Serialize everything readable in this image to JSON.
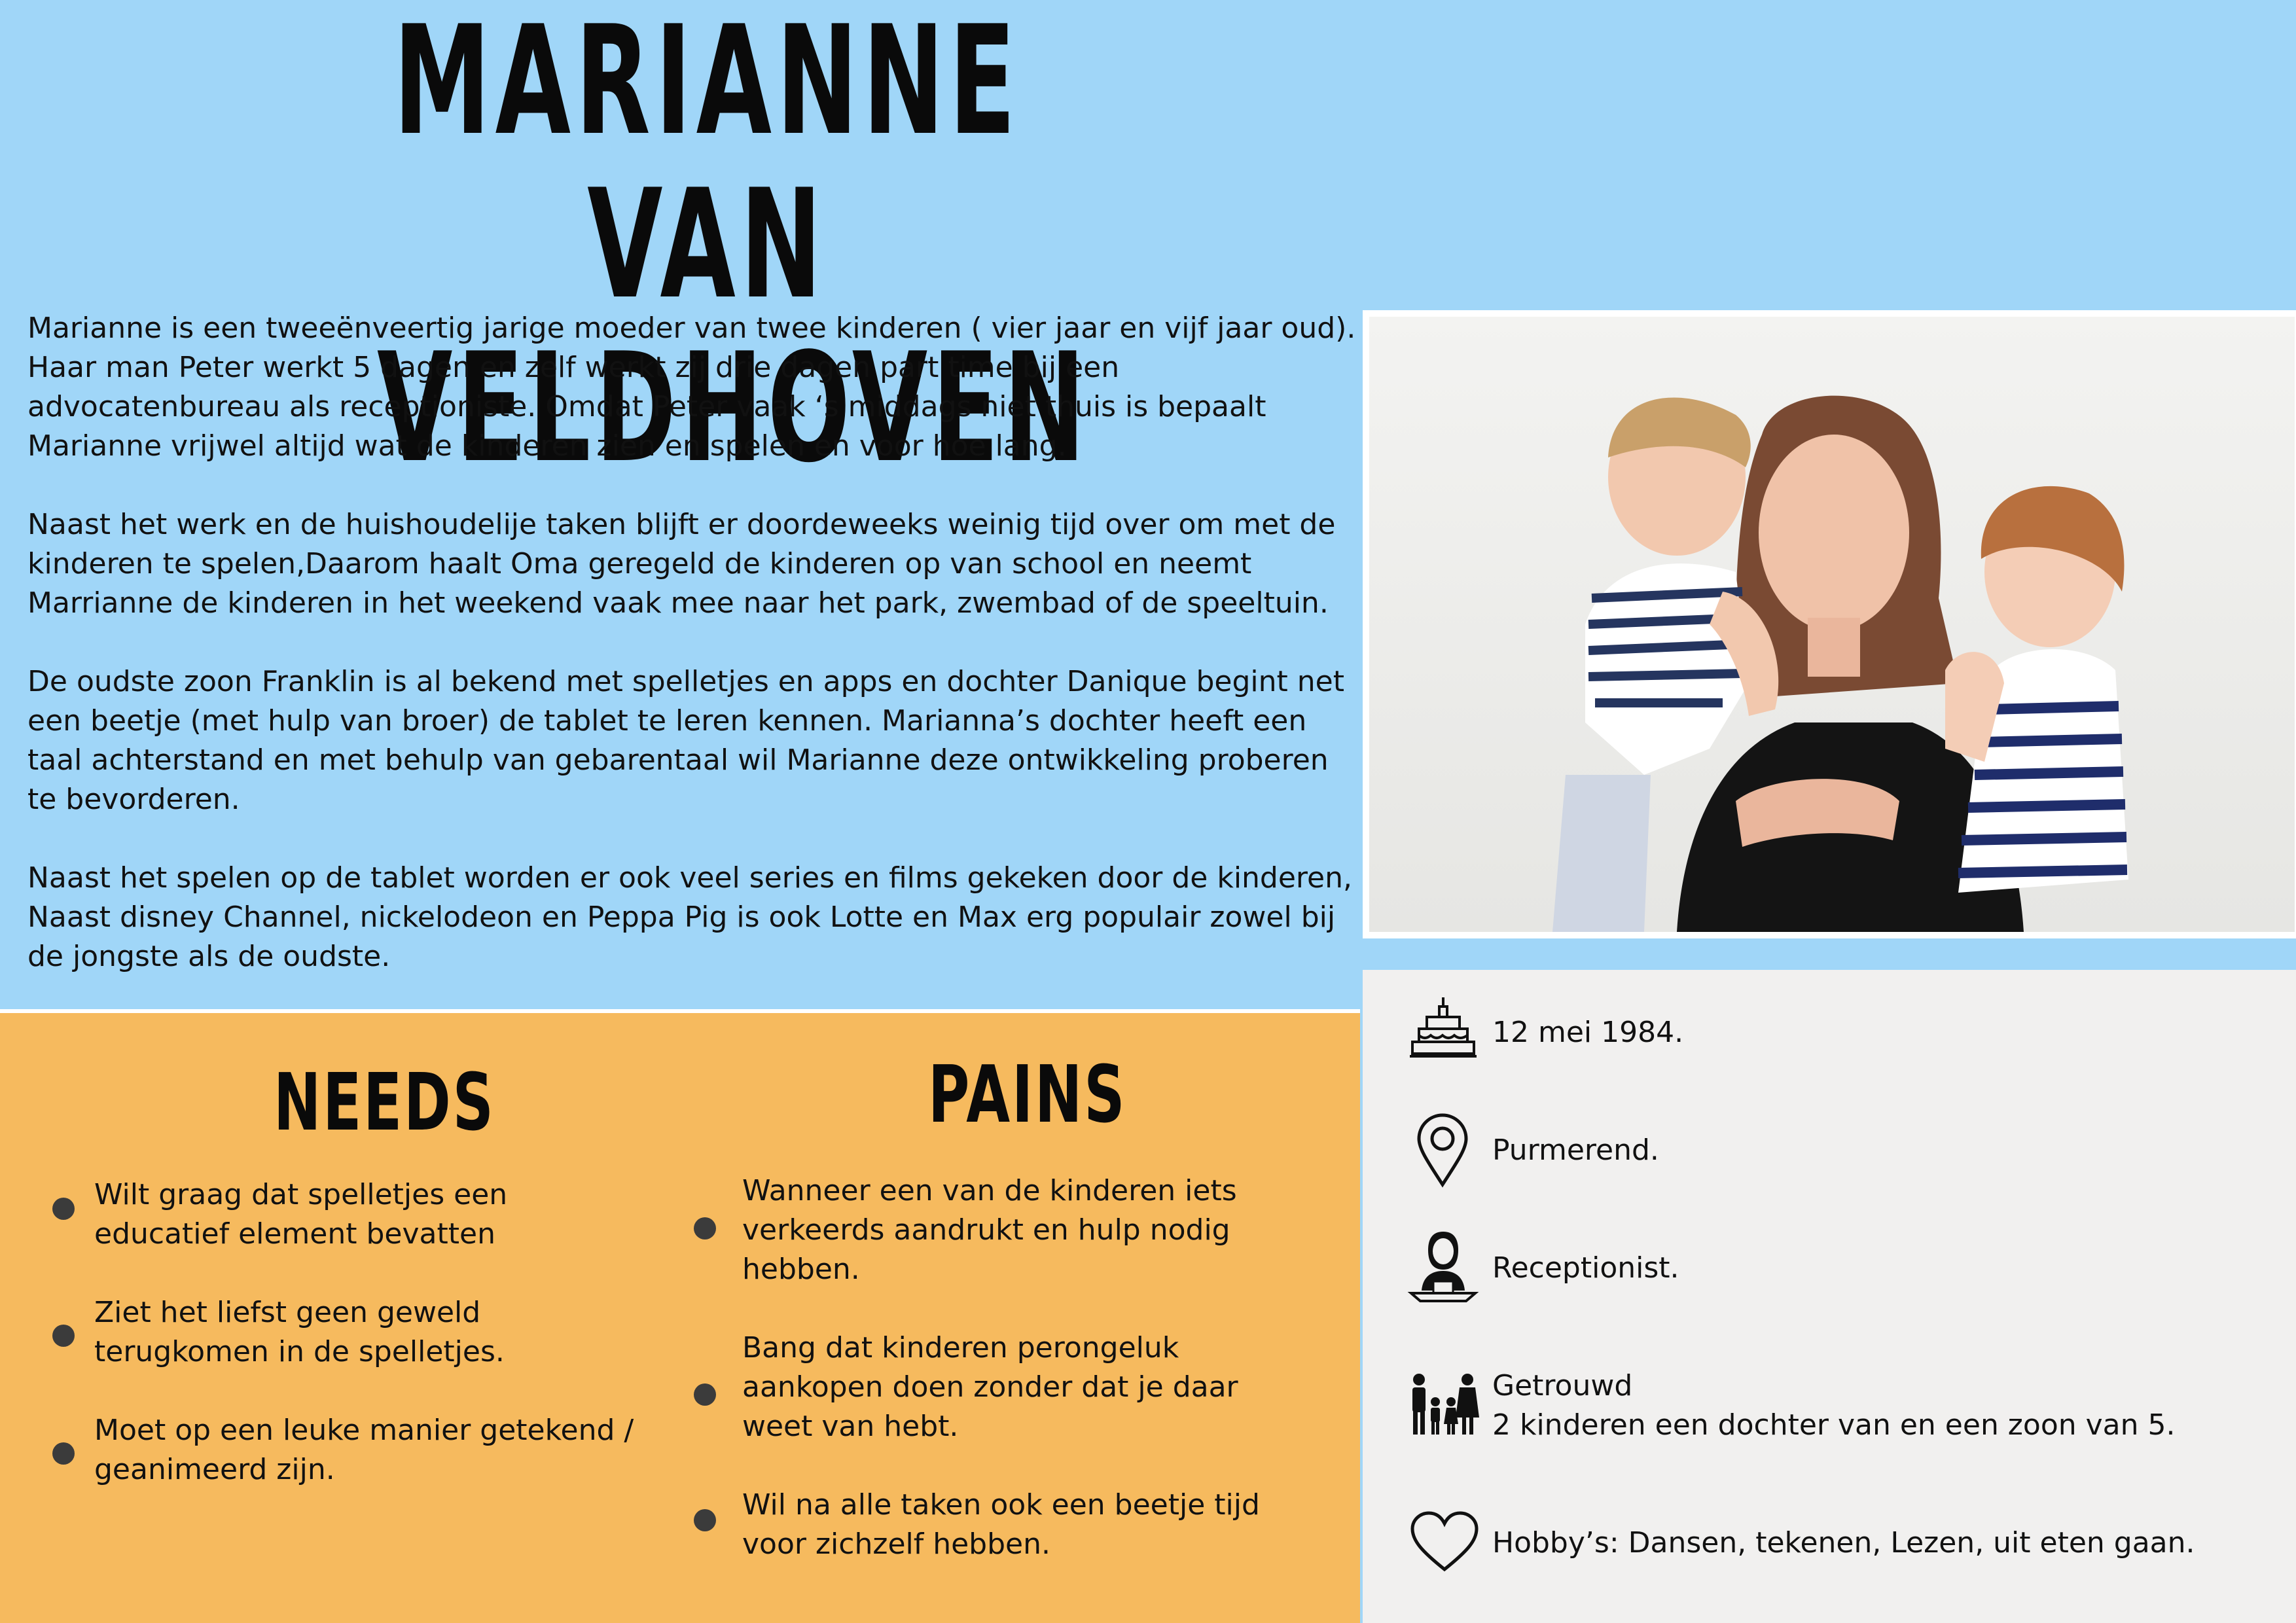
{
  "header": {
    "name_line1": "MARIANNE",
    "name_line2": "VAN VELDHOVEN"
  },
  "bio": {
    "paragraph1": "Marianne is een tweeënveertig jarige moeder van twee kinderen ( vier jaar en vijf jaar oud). Haar man Peter werkt 5 dagen en zelf werkt zij drie dagen part time bij een advocatenbureau als receptioniste. Omdat Peter vaak ‘s middags niet thuis is bepaalt Marianne vrijwel altijd wat de kinderen zien en spelen en voor hoe lang.",
    "paragraph2": "Naast het werk en de huishoudelije taken blijft er doordeweeks weinig tijd over om met de kinderen te spelen,Daarom  haalt Oma geregeld de kinderen op van school en neemt Marrianne de kinderen in het weekend vaak mee naar het park, zwembad of de speeltuin.",
    "paragraph3": "De oudste zoon Franklin is al bekend met  spelletjes en apps en dochter Danique begint net een beetje (met hulp van broer) de tablet te leren kennen.  Marianna’s dochter heeft een taal achterstand en met behulp van gebarentaal wil Marianne deze ontwikkeling proberen te bevorderen.",
    "paragraph4": "Naast het spelen op de tablet worden er ook veel series en films gekeken door de kinderen, Naast disney Channel, nickelodeon en Peppa Pig is ook Lotte en Max erg populair zowel bij de jongste als de oudste."
  },
  "needs": {
    "title": "NEEDS",
    "items": [
      " Wilt graag dat spelletjes een educatief element bevatten",
      "Ziet het liefst geen geweld terugkomen in de spelletjes.",
      "Moet op een leuke manier getekend / geanimeerd zijn."
    ]
  },
  "pains": {
    "title": "PAINS",
    "items": [
      "Wanneer een van de kinderen iets verkeerds aandrukt en hulp nodig hebben.",
      "Bang dat kinderen perongeluk aankopen doen zonder dat je daar weet van hebt.",
      "Wil na alle taken ook een beetje tijd voor zichzelf hebben."
    ]
  },
  "info": {
    "birthday": "12 mei 1984.",
    "location": "Purmerend.",
    "job": "Receptionist.",
    "family_line1": "Getrouwd",
    "family_line2": "2 kinderen een dochter van  en een zoon  van 5.",
    "hobbies": "Hobby’s: Dansen, tekenen, Lezen, uit eten gaan."
  },
  "icons": {
    "birthday": "birthday-cake-icon",
    "location": "map-pin-icon",
    "job": "receptionist-icon",
    "family": "family-icon",
    "hobbies": "heart-icon"
  },
  "colors": {
    "background_blue": "#a0d6f8",
    "needs_orange": "#f6ba5e",
    "info_grey": "#f1f0ef"
  }
}
